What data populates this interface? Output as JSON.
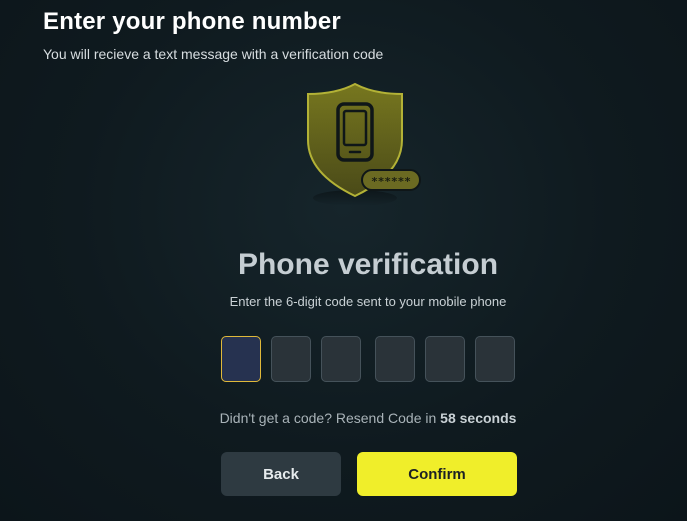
{
  "header": {
    "title": "Enter your phone number",
    "subtitle": "You will recieve a text message with a verification code"
  },
  "illustration": {
    "icon": "shield-phone-icon",
    "password_mask": "******",
    "colors": {
      "shield": "#5e5e1d",
      "shield_outline": "#b3b236",
      "phone_stroke": "#0f1618",
      "pill": "#6b6a22"
    }
  },
  "card": {
    "title": "Phone verification",
    "subtitle": "Enter the 6-digit code sent to your mobile phone"
  },
  "code": {
    "digits": [
      "",
      "",
      "",
      "",
      "",
      ""
    ],
    "active_index": 0
  },
  "resend": {
    "prefix": "Didn't get a code? Resend Code in",
    "countdown": "58 seconds"
  },
  "buttons": {
    "back_label": "Back",
    "confirm_label": "Confirm"
  },
  "colors": {
    "accent": "#f0ee2a",
    "active_border": "#e0b93a",
    "background": "#0f1a1f"
  }
}
